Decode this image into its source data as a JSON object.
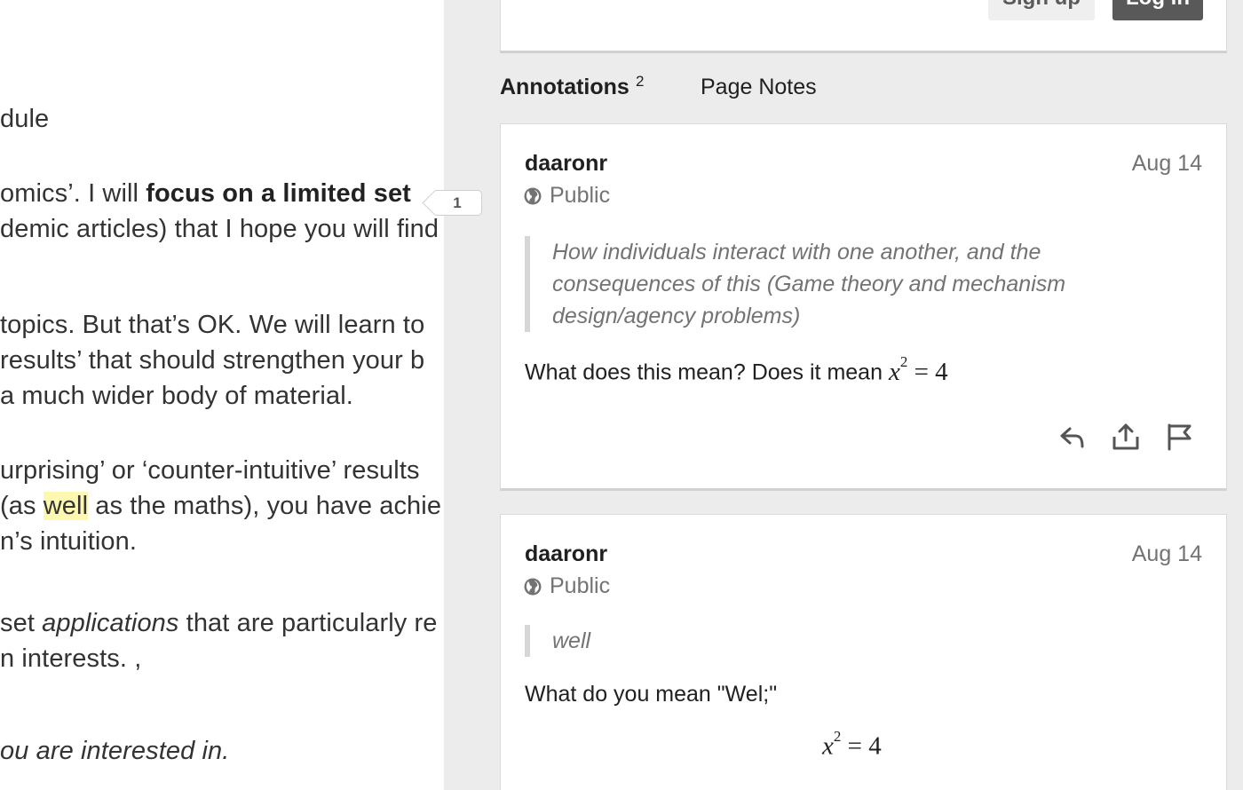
{
  "document": {
    "lines": [
      {
        "id": "l1",
        "parts": [
          {
            "t": "dule"
          }
        ]
      },
      {
        "id": "l2",
        "parts": [
          {
            "t": "omics’. I will "
          },
          {
            "t": "focus on a limited set",
            "b": true
          }
        ]
      },
      {
        "id": "l3",
        "parts": [
          {
            "t": "demic articles) that I hope you will find"
          }
        ]
      },
      {
        "id": "l4",
        "parts": [
          {
            "t": "topics. But that’s OK. We will learn to"
          }
        ]
      },
      {
        "id": "l5",
        "parts": [
          {
            "t": " results’ that should strengthen your b"
          }
        ]
      },
      {
        "id": "l6",
        "parts": [
          {
            "t": "a much wider body of material."
          }
        ]
      },
      {
        "id": "l7",
        "parts": [
          {
            "t": "urprising’ or ‘counter-intuitive’ results"
          }
        ]
      },
      {
        "id": "l8",
        "parts": [
          {
            "t": "(as "
          },
          {
            "t": "well",
            "hl": true
          },
          {
            "t": " as the maths), you have achie"
          }
        ]
      },
      {
        "id": "l9",
        "parts": [
          {
            "t": "n’s intuition."
          }
        ]
      },
      {
        "id": "l10",
        "parts": [
          {
            "t": "set "
          },
          {
            "t": "applications",
            "i": true
          },
          {
            "t": " that are particularly re"
          }
        ]
      },
      {
        "id": "l11",
        "parts": [
          {
            "t": "n interests. ,"
          }
        ]
      },
      {
        "id": "l12",
        "parts": [
          {
            "t": "ou are interested in.",
            "i": true
          }
        ]
      }
    ]
  },
  "sidebar": {
    "bucket_count": "1",
    "signup_label": "Sign up",
    "login_label": "Log in",
    "tabs": {
      "annotations_label": "Annotations",
      "annotations_count": "2",
      "page_notes_label": "Page Notes"
    },
    "annotations": [
      {
        "user": "daaronr",
        "date": "Aug 14",
        "privacy": "Public",
        "quote": "How individuals interact with one another, and the consequences of this (Game theory and mechanism design/agency problems)",
        "body_text": "What does this mean? Does it mean ",
        "math": {
          "var": "x",
          "exp": "2",
          "rest": " = 4"
        }
      },
      {
        "user": "daaronr",
        "date": "Aug 14",
        "privacy": "Public",
        "quote": "well",
        "body_text": "What do you mean \"Wel;\"",
        "math": {
          "var": "x",
          "exp": "2",
          "rest": " = 4"
        }
      }
    ],
    "actions": {
      "reply_icon": "reply-icon",
      "share_icon": "share-icon",
      "flag_icon": "flag-icon"
    }
  }
}
